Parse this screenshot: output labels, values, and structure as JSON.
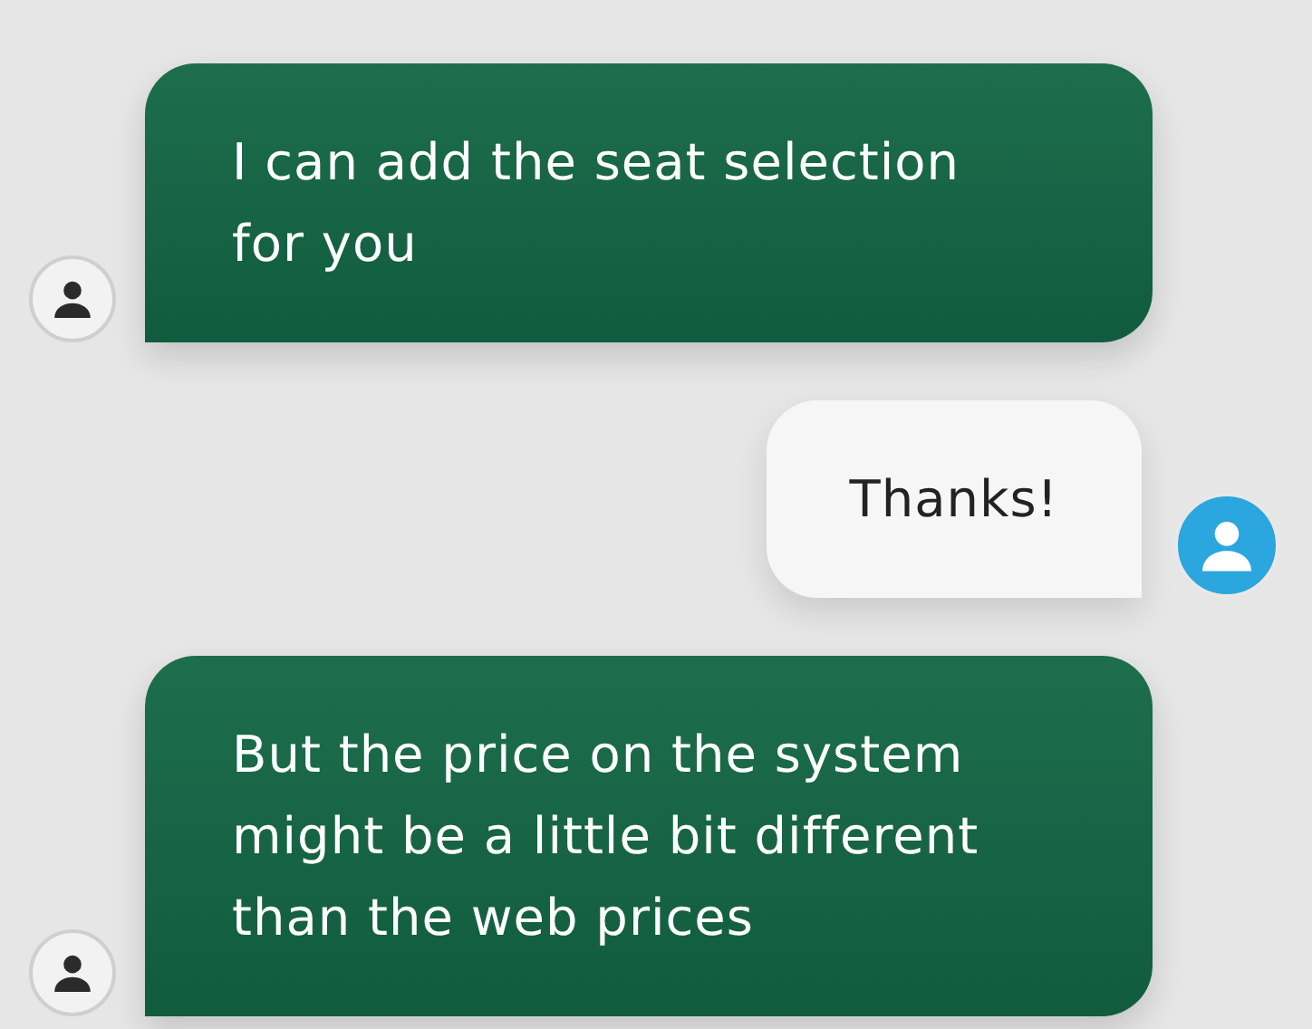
{
  "messages": [
    {
      "kind": "agent",
      "text": "I can add the seat selection for you"
    },
    {
      "kind": "user",
      "text": "Thanks!"
    },
    {
      "kind": "agent",
      "text": "But the price on the system might be a little bit different than the web prices"
    }
  ]
}
